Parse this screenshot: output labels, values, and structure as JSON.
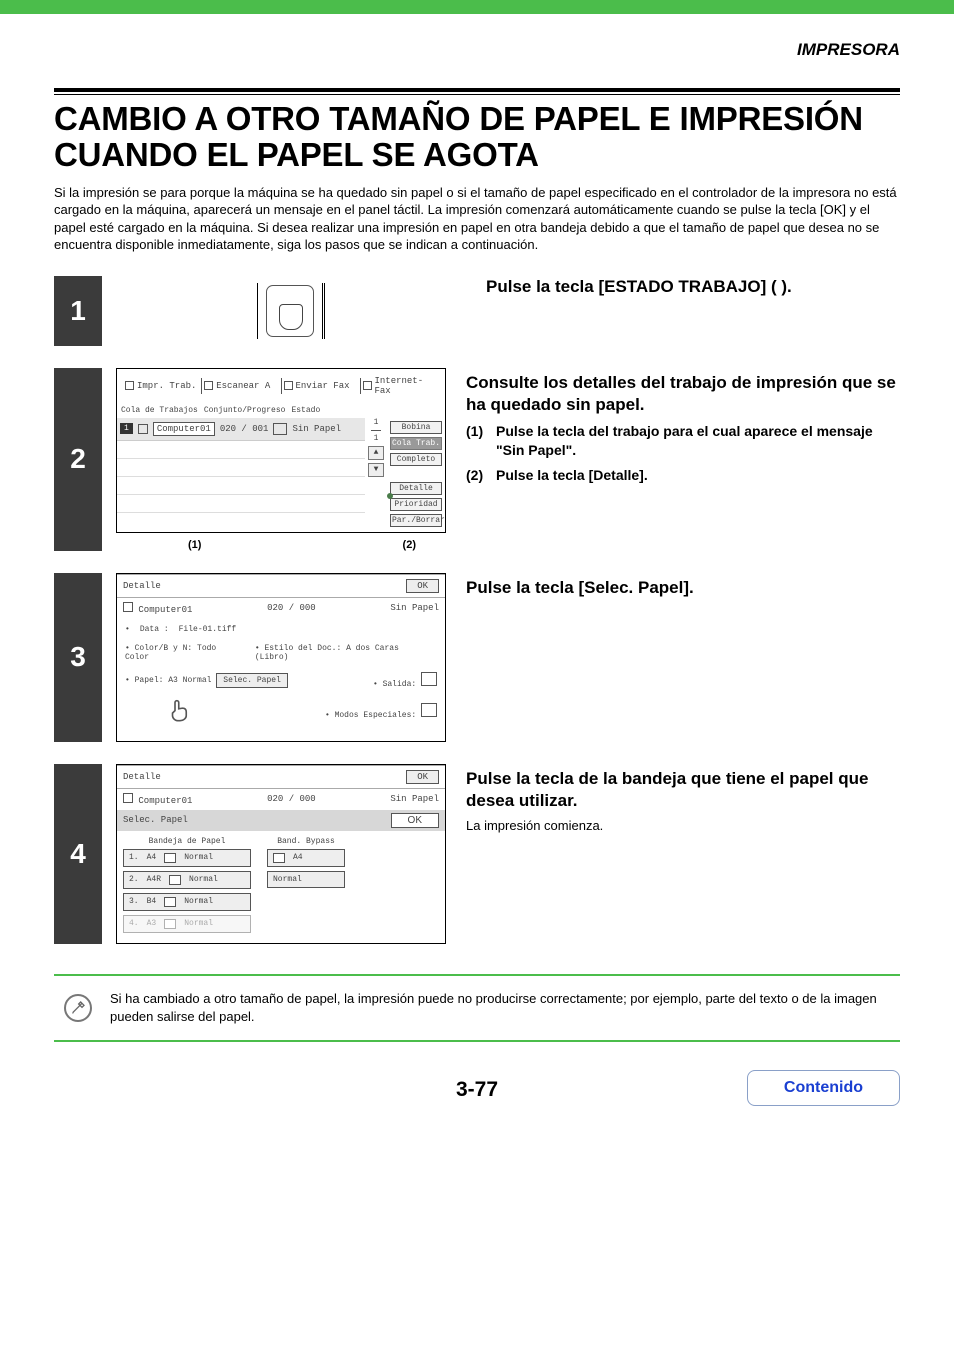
{
  "header_label": "IMPRESORA",
  "title": "CAMBIO A OTRO TAMAÑO DE PAPEL E IMPRESIÓN CUANDO EL PAPEL SE AGOTA",
  "intro": "Si la impresión se para porque la máquina se ha quedado sin papel o si el tamaño de papel especificado en el controlador de la impresora no está cargado en la máquina, aparecerá un mensaje en el panel táctil. La impresión comenzará automáticamente cuando se pulse la tecla [OK] y el papel esté cargado en la máquina. Si desea realizar una impresión en papel en otra bandeja debido a que el tamaño de papel que desea no se encuentra disponible inmediatamente, siga los pasos que se indican a continuación.",
  "panel2": {
    "tabs": [
      "Impr. Trab.",
      "Escanear A",
      "Enviar Fax",
      "Internet-Fax"
    ],
    "cols": [
      "Cola de Trabajos",
      "Conjunto/Progreso",
      "Estado"
    ],
    "job": {
      "idx": "1",
      "name": "Computer01",
      "progress": "020 / 001",
      "status": "Sin Papel"
    },
    "side": {
      "spool": "Bobina",
      "queue": "Cola Trab.",
      "complete": "Completo",
      "detail": "Detalle",
      "priority": "Prioridad",
      "stop": "Par./Borrar"
    },
    "scroll": {
      "frac_top": "1",
      "frac_bot": "1"
    },
    "callout1": "(1)",
    "callout2": "(2)"
  },
  "panel3": {
    "title": "Detalle",
    "ok": "OK",
    "job": "Computer01",
    "progress": "020 / 000",
    "status": "Sin Papel",
    "data_label": "Data :",
    "data_value": "File-01.tiff",
    "color_label": "Color/B y N:",
    "color_value": "Todo Color",
    "style_label": "Estilo del Doc.:",
    "style_value": "A dos Caras (Libro)",
    "paper_label": "Papel:",
    "paper_value": "A3 Normal",
    "select_paper": "Selec. Papel",
    "output_label": "Salida:",
    "modes_label": "Modos Especiales:"
  },
  "panel4": {
    "title": "Detalle",
    "ok1": "OK",
    "job": "Computer01",
    "progress": "020 / 000",
    "status": "Sin Papel",
    "sp_title": "Selec. Papel",
    "ok2": "OK",
    "col_tray": "Bandeja de Papel",
    "col_bypass": "Band. Bypass",
    "trays": [
      {
        "slot": "1.",
        "size": "A4",
        "type": "Normal",
        "disabled": false
      },
      {
        "slot": "2.",
        "size": "A4R",
        "type": "Normal",
        "disabled": false
      },
      {
        "slot": "3.",
        "size": "B4",
        "type": "Normal",
        "disabled": false
      },
      {
        "slot": "4.",
        "size": "A3",
        "type": "Normal",
        "disabled": true
      }
    ],
    "bypass": {
      "size": "A4",
      "type": "Normal"
    }
  },
  "steps": {
    "s1": {
      "num": "1",
      "heading": "Pulse la tecla [ESTADO TRABAJO] (     )."
    },
    "s2": {
      "num": "2",
      "heading": "Consulte los detalles del trabajo de impresión que se ha quedado sin papel.",
      "sub1_lbl": "(1)",
      "sub1_txt": "Pulse la tecla del trabajo para el cual aparece el mensaje \"Sin Papel\".",
      "sub2_lbl": "(2)",
      "sub2_txt": "Pulse la tecla [Detalle]."
    },
    "s3": {
      "num": "3",
      "heading": "Pulse la tecla [Selec. Papel]."
    },
    "s4": {
      "num": "4",
      "heading": "Pulse la tecla de la bandeja que tiene el papel que desea utilizar.",
      "body": "La impresión comienza."
    }
  },
  "note": "Si ha cambiado a otro tamaño de papel, la impresión puede no producirse correctamente; por ejemplo, parte del texto o de la imagen pueden salirse del papel.",
  "page_num": "3-77",
  "contenido": "Contenido"
}
